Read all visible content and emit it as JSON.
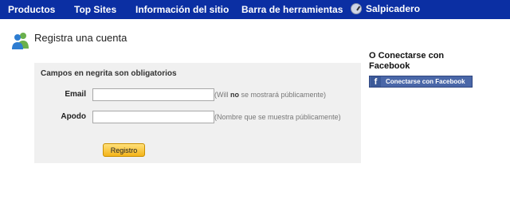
{
  "nav": {
    "items": [
      "Productos",
      "Top Sites",
      "Información del sitio",
      "Barra de herramientas",
      "Salpicadero"
    ],
    "background": "#0b2fa3"
  },
  "header": {
    "icon": "users-icon",
    "title": "Registra una cuenta"
  },
  "form": {
    "required_note": "Campos en negrita son obligatorios",
    "email": {
      "label": "Email",
      "value": "",
      "hint_before": "(Will ",
      "hint_bold": "no",
      "hint_after": " se mostrará públicamente)"
    },
    "nickname": {
      "label": "Apodo",
      "value": "",
      "hint": "(Nombre que se muestra públicamente)"
    },
    "submit_label": "Registro"
  },
  "facebook": {
    "heading": "O Conectarse con Facebook",
    "icon": "facebook-icon",
    "icon_glyph": "f",
    "button_label": "Conectarse con Facebook",
    "brand_color": "#3b5998"
  }
}
